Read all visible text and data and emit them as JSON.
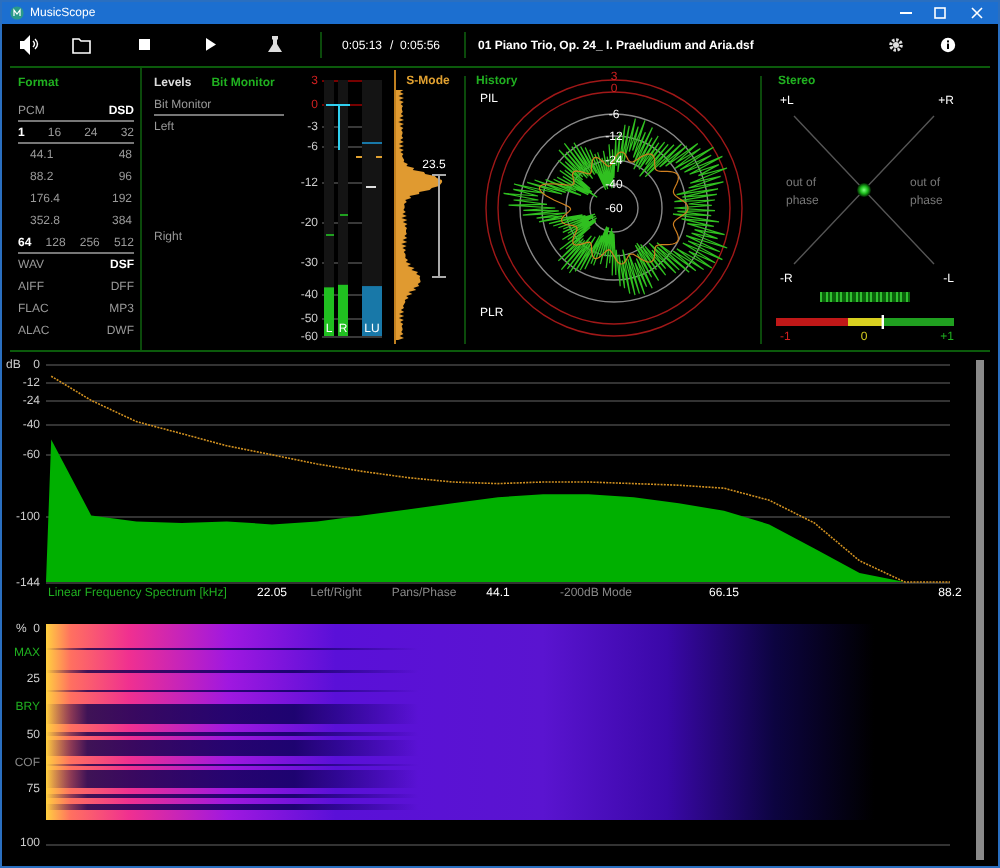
{
  "window": {
    "title": "MusicScope"
  },
  "toolbar": {
    "elapsed": "0:05:13",
    "separator": "/",
    "duration": "0:05:56",
    "file": "01 Piano Trio, Op. 24_ I. Praeludium and Aria.dsf"
  },
  "format": {
    "title": "Format",
    "rows": [
      {
        "kind": "pair",
        "items": [
          {
            "label": "PCM",
            "on": false
          },
          {
            "label": "DSD",
            "on": true
          }
        ]
      },
      {
        "kind": "divider"
      },
      {
        "kind": "quad",
        "items": [
          {
            "label": "1",
            "on": true
          },
          {
            "label": "16",
            "on": false
          },
          {
            "label": "24",
            "on": false
          },
          {
            "label": "32",
            "on": false
          }
        ]
      },
      {
        "kind": "divider"
      },
      {
        "kind": "rate",
        "items": [
          {
            "label": "44.1",
            "on": false
          },
          {
            "label": "48",
            "on": false
          }
        ]
      },
      {
        "kind": "rate",
        "items": [
          {
            "label": "88.2",
            "on": false
          },
          {
            "label": "96",
            "on": false
          }
        ]
      },
      {
        "kind": "rate",
        "items": [
          {
            "label": "176.4",
            "on": false
          },
          {
            "label": "192",
            "on": false
          }
        ]
      },
      {
        "kind": "rate",
        "items": [
          {
            "label": "352.8",
            "on": false
          },
          {
            "label": "384",
            "on": false
          }
        ]
      },
      {
        "kind": "quad",
        "items": [
          {
            "label": "64",
            "on": true
          },
          {
            "label": "128",
            "on": false
          },
          {
            "label": "256",
            "on": false
          },
          {
            "label": "512",
            "on": false
          }
        ]
      },
      {
        "kind": "divider"
      },
      {
        "kind": "pair",
        "items": [
          {
            "label": "WAV",
            "on": false
          },
          {
            "label": "DSF",
            "on": true
          }
        ]
      },
      {
        "kind": "pair",
        "items": [
          {
            "label": "AIFF",
            "on": false
          },
          {
            "label": "DFF",
            "on": false
          }
        ]
      },
      {
        "kind": "pair",
        "items": [
          {
            "label": "FLAC",
            "on": false
          },
          {
            "label": "MP3",
            "on": false
          }
        ]
      },
      {
        "kind": "pair",
        "items": [
          {
            "label": "ALAC",
            "on": false
          },
          {
            "label": "DWF",
            "on": false
          }
        ]
      }
    ]
  },
  "levels": {
    "title": "Levels",
    "mode": "Bit Monitor",
    "section": "Bit Monitor",
    "channels": [
      "Left",
      "Right"
    ]
  },
  "meter": {
    "scale": [
      {
        "label": "3",
        "kind": "clip"
      },
      {
        "label": "0",
        "kind": "clip"
      },
      {
        "label": "-3",
        "kind": "normal"
      },
      {
        "label": "-6",
        "kind": "normal"
      },
      {
        "label": "-12",
        "kind": "normal"
      },
      {
        "label": "-20",
        "kind": "normal"
      },
      {
        "label": "-30",
        "kind": "normal"
      },
      {
        "label": "-40",
        "kind": "normal"
      },
      {
        "label": "-50",
        "kind": "normal"
      },
      {
        "label": "-60",
        "kind": "normal"
      }
    ],
    "bars": [
      {
        "label": "L",
        "level": 0.19,
        "color": "#20c020"
      },
      {
        "label": "R",
        "level": 0.2,
        "color": "#20c020"
      },
      {
        "label": "LU",
        "level": 0.195,
        "color": "#1878a8"
      }
    ]
  },
  "s_mode": {
    "title": "S-Mode",
    "value": "23.5"
  },
  "history": {
    "title": "History",
    "top_label": "PIL",
    "bottom_label": "PLR",
    "rings": [
      {
        "label": "3",
        "kind": "clip"
      },
      {
        "label": "0",
        "kind": "clip"
      },
      {
        "label": "-6",
        "kind": "normal"
      },
      {
        "label": "-12",
        "kind": "normal"
      },
      {
        "label": "-24",
        "kind": "normal"
      },
      {
        "label": "-40",
        "kind": "normal"
      },
      {
        "label": "-60",
        "kind": "normal"
      }
    ]
  },
  "stereo": {
    "title": "Stereo",
    "corners": [
      "+L",
      "+R",
      "-R",
      "-L"
    ],
    "notes": [
      "out of phase",
      "out of phase"
    ],
    "correlation": {
      "level": 0.6,
      "labels": [
        "-1",
        "0",
        "+1"
      ]
    }
  },
  "spectrum": {
    "chart_data": {
      "type": "area",
      "xlabel": "Linear Frequency Spectrum [kHz]",
      "ylabel": "dB",
      "x": [
        0,
        0.5,
        4.41,
        8.82,
        13.23,
        17.64,
        22.05,
        26.46,
        30.87,
        35.28,
        39.69,
        44.1,
        48.51,
        52.92,
        57.33,
        61.74,
        66.15,
        70.56,
        74.97,
        79.38,
        83.79,
        88.2
      ],
      "series": [
        {
          "color": "#00b000",
          "values": [
            -144,
            -50,
            -100,
            -104,
            -105,
            -104,
            -106,
            -104,
            -100,
            -96,
            -92,
            -88,
            -86,
            -86,
            -88,
            -92,
            -97,
            -106,
            -122,
            -138,
            -144,
            -144
          ]
        },
        {
          "type": "line",
          "line_style": "dashed",
          "color": "#d09020",
          "values": [
            null,
            -8,
            -24,
            -38,
            -46,
            -54,
            -60,
            -66,
            -71,
            -75,
            -78,
            -79,
            -78,
            -78,
            -79,
            -80,
            -82,
            -90,
            -105,
            -130,
            -144,
            -144
          ]
        }
      ],
      "grid": true,
      "xlim": [
        0,
        88.2
      ],
      "ylim": [
        -144,
        0
      ],
      "xticks": [
        22.05,
        44.1,
        66.15,
        88.2
      ],
      "yticks": [
        0,
        -12,
        -24,
        -40,
        -60,
        -100,
        -144
      ]
    },
    "options": [
      "Left/Right",
      "Pans/Phase",
      "-200dB Mode"
    ]
  },
  "spectrogram": {
    "unit": "%",
    "ticks": [
      "0",
      "25",
      "50",
      "75",
      "100"
    ],
    "modes": [
      {
        "label": "MAX",
        "on": true
      },
      {
        "label": "BRY",
        "on": true
      },
      {
        "label": "COF",
        "on": false
      }
    ]
  }
}
